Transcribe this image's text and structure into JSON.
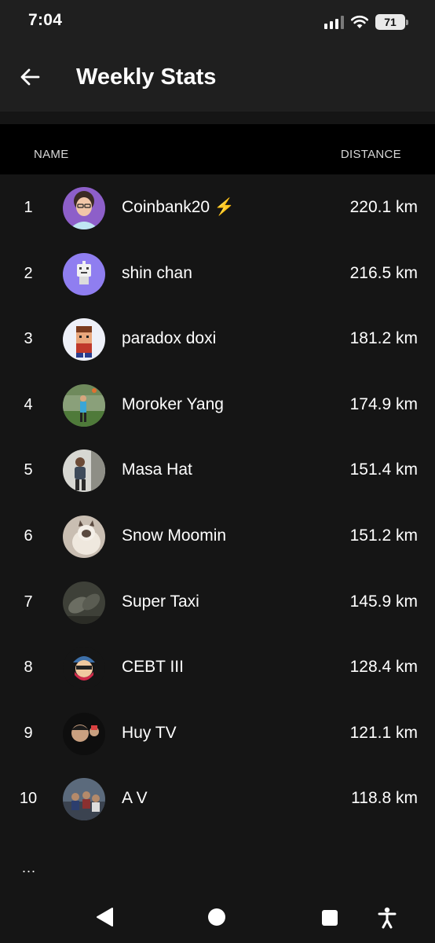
{
  "status": {
    "time": "7:04",
    "battery": "71"
  },
  "header": {
    "title": "Weekly Stats"
  },
  "columns": {
    "name": "NAME",
    "distance": "DISTANCE"
  },
  "leaderboard": [
    {
      "rank": "1",
      "name": "Coinbank20 ⚡",
      "distance": "220.1 km"
    },
    {
      "rank": "2",
      "name": "shin chan",
      "distance": "216.5 km"
    },
    {
      "rank": "3",
      "name": "paradox doxi",
      "distance": "181.2 km"
    },
    {
      "rank": "4",
      "name": "Moroker Yang",
      "distance": "174.9 km"
    },
    {
      "rank": "5",
      "name": "Masa Hat",
      "distance": "151.4 km"
    },
    {
      "rank": "6",
      "name": "Snow Moomin",
      "distance": "151.2 km"
    },
    {
      "rank": "7",
      "name": "Super Taxi",
      "distance": "145.9 km"
    },
    {
      "rank": "8",
      "name": "CEBT III",
      "distance": "128.4 km"
    },
    {
      "rank": "9",
      "name": "Huy TV",
      "distance": "121.1 km"
    },
    {
      "rank": "10",
      "name": "A V",
      "distance": "118.8 km"
    }
  ],
  "more_indicator": "...",
  "colors": {
    "background": "#151515",
    "topbar": "#1f1f1f",
    "header_row": "#000000",
    "text": "#ffffff"
  },
  "icons": {
    "back": "arrow-left-icon",
    "nav": [
      "back-triangle-icon",
      "home-circle-icon",
      "recents-square-icon",
      "accessibility-icon"
    ]
  }
}
